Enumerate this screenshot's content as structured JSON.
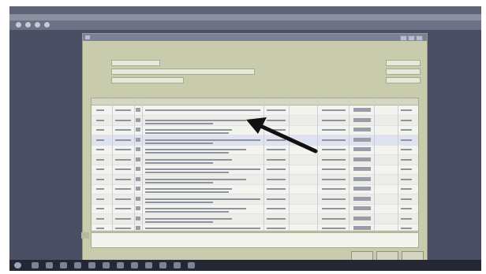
{
  "host_window": {
    "title": "",
    "menu": ""
  },
  "dialog": {
    "title": "",
    "heading_line1": "",
    "heading_line2": "",
    "fields_left": [
      {
        "label": "",
        "value": ""
      },
      {
        "label": "",
        "value": ""
      },
      {
        "label": "",
        "value": ""
      }
    ],
    "fields_right": [
      {
        "label": "",
        "value": ""
      },
      {
        "label": "",
        "value": ""
      },
      {
        "label": "",
        "value": ""
      }
    ],
    "table": {
      "columns": [
        "",
        "",
        "",
        "",
        "",
        "",
        "",
        "",
        "",
        ""
      ],
      "row_count": 13,
      "selected_row": 3
    },
    "buttons": {
      "button_1": "",
      "button_2": "",
      "button_3": ""
    }
  },
  "annotation": {
    "arrow": "black-arrow-pointing-at-selected-row",
    "color": "#111111"
  }
}
